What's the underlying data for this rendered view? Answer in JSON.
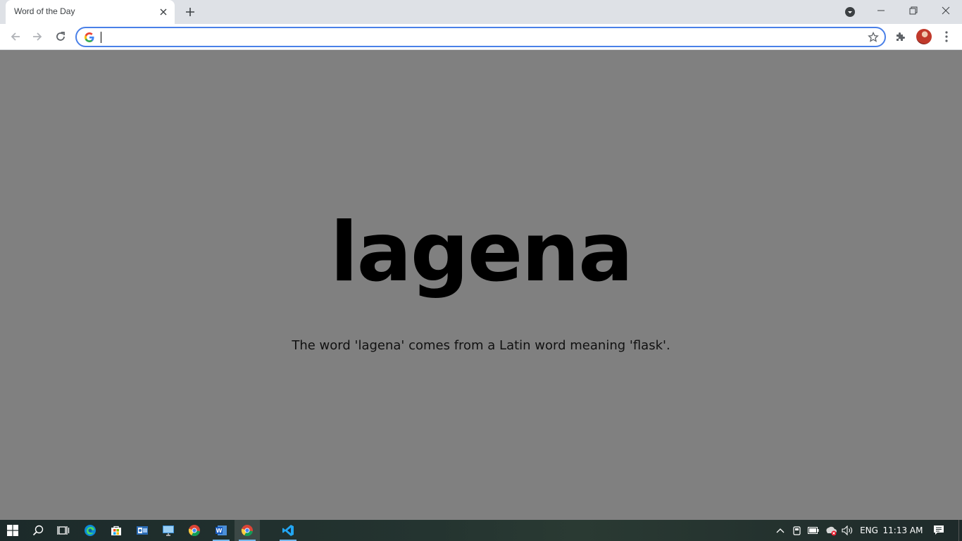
{
  "browser": {
    "tab_title": "Word of the Day",
    "omnibox_value": "",
    "omnibox_placeholder": ""
  },
  "page": {
    "word": "lagena",
    "meaning": "The word 'lagena' comes from a Latin word meaning 'flask'.",
    "background_color": "#808080"
  },
  "taskbar": {
    "apps": [
      "windows-start",
      "search",
      "task-view",
      "edge",
      "store",
      "outlook",
      "remote-desktop",
      "chrome",
      "word",
      "chrome-active",
      "vscode"
    ],
    "language": "ENG",
    "time": "11:13 AM"
  }
}
